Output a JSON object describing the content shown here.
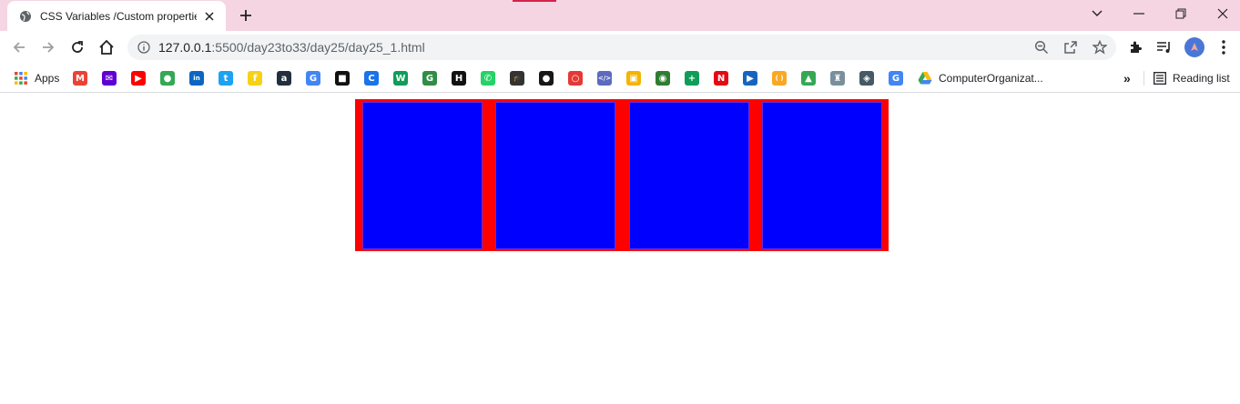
{
  "browser": {
    "tab": {
      "title": "CSS Variables /Custom properties",
      "favicon": "globe-icon"
    },
    "new_tab": "plus-icon",
    "window_controls": [
      "chevron-down-icon",
      "minimize-icon",
      "restore-icon",
      "close-icon"
    ],
    "address_bar": {
      "host": "127.0.0.1",
      "path": ":5500/day23to33/day25/day25_1.html",
      "info_icon": "info-icon"
    },
    "toolbar_icons": [
      "back-icon",
      "forward-icon",
      "reload-icon",
      "home-icon",
      "zoom-icon",
      "share-icon",
      "star-icon",
      "extensions-icon",
      "media-icon",
      "profile-avatar",
      "menu-icon"
    ]
  },
  "bookmarks": {
    "apps_label": "Apps",
    "items": [
      {
        "icon": "gmail-icon",
        "color": "#ea4335",
        "glyph": "M"
      },
      {
        "icon": "mail-icon",
        "color": "#6001d2",
        "glyph": "✉"
      },
      {
        "icon": "youtube-icon",
        "color": "#ff0000",
        "glyph": "▶"
      },
      {
        "icon": "maps-icon",
        "color": "#34a853",
        "glyph": "●"
      },
      {
        "icon": "linkedin-icon",
        "color": "#0a66c2",
        "glyph": "in"
      },
      {
        "icon": "twitter-icon",
        "color": "#1da1f2",
        "glyph": "t"
      },
      {
        "icon": "flipkart-icon",
        "color": "#f7d116",
        "glyph": "f"
      },
      {
        "icon": "amazon-icon",
        "color": "#232f3e",
        "glyph": "a"
      },
      {
        "icon": "google-icon",
        "color": "#4285f4",
        "glyph": "G"
      },
      {
        "icon": "box-icon",
        "color": "#111111",
        "glyph": "■"
      },
      {
        "icon": "c-icon",
        "color": "#1a73e8",
        "glyph": "C"
      },
      {
        "icon": "w-icon",
        "color": "#0f9d58",
        "glyph": "W"
      },
      {
        "icon": "geeksforgeeks-icon",
        "color": "#2f8d46",
        "glyph": "G"
      },
      {
        "icon": "hackerrank-icon",
        "color": "#111111",
        "glyph": "H"
      },
      {
        "icon": "whatsapp-icon",
        "color": "#25d366",
        "glyph": "✆"
      },
      {
        "icon": "graduation-cap-icon",
        "color": "#333333",
        "glyph": "🎓"
      },
      {
        "icon": "github-icon",
        "color": "#181717",
        "glyph": "●"
      },
      {
        "icon": "ring-icon",
        "color": "#e53935",
        "glyph": "○"
      },
      {
        "icon": "code-icon",
        "color": "#5c6bc0",
        "glyph": "</>"
      },
      {
        "icon": "classroom-icon",
        "color": "#f4b400",
        "glyph": "▣"
      },
      {
        "icon": "circle-icon",
        "color": "#2e7d32",
        "glyph": "◉"
      },
      {
        "icon": "sheets-icon",
        "color": "#0f9d58",
        "glyph": "+"
      },
      {
        "icon": "netflix-icon",
        "color": "#e50914",
        "glyph": "N"
      },
      {
        "icon": "play-icon",
        "color": "#1565c0",
        "glyph": "▶"
      },
      {
        "icon": "brackets-icon",
        "color": "#f9a825",
        "glyph": "( )"
      },
      {
        "icon": "drive-icon",
        "color": "#34a853",
        "glyph": "▲"
      },
      {
        "icon": "tower-icon",
        "color": "#78909c",
        "glyph": "♜"
      },
      {
        "icon": "shield-icon",
        "color": "#455a64",
        "glyph": "◈"
      },
      {
        "icon": "google-icon",
        "color": "#4285f4",
        "glyph": "G"
      }
    ],
    "last_item": {
      "icon": "drive-icon",
      "label": "ComputerOrganizat..."
    },
    "overflow": "»",
    "reading_list_label": "Reading list"
  },
  "page": {
    "container_color": "#ff0000",
    "box_color": "#0000ff",
    "box_count": 4
  }
}
